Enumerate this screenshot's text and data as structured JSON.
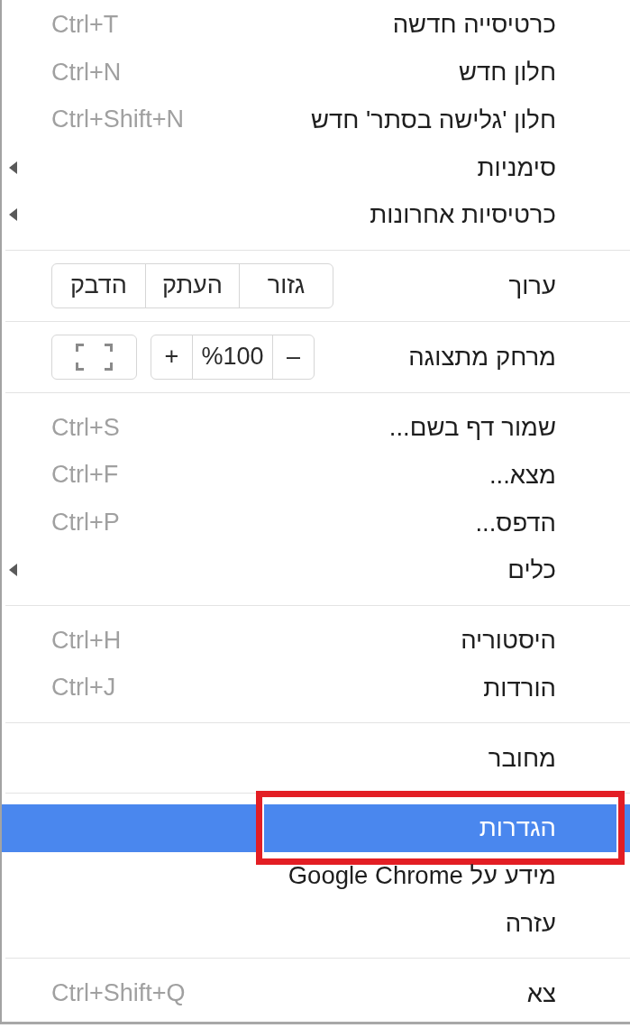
{
  "menu": {
    "sections": [
      {
        "rows": [
          {
            "kind": "item",
            "label": "כרטיסייה חדשה",
            "shortcut": "Ctrl+T",
            "submenu": false,
            "selected": false,
            "framed": false
          },
          {
            "kind": "item",
            "label": "חלון חדש",
            "shortcut": "Ctrl+N",
            "submenu": false,
            "selected": false,
            "framed": false
          },
          {
            "kind": "item",
            "label": "חלון 'גלישה בסתר' חדש",
            "shortcut": "Ctrl+Shift+N",
            "submenu": false,
            "selected": false,
            "framed": false
          },
          {
            "kind": "item",
            "label": "סימניות",
            "submenu": true,
            "selected": false,
            "framed": false
          },
          {
            "kind": "item",
            "label": "כרטיסיות אחרונות",
            "submenu": true,
            "selected": false,
            "framed": false
          }
        ]
      },
      {
        "rows": [
          {
            "kind": "edit",
            "label": "ערוך",
            "buttons": [
              "גזור",
              "העתק",
              "הדבק"
            ]
          }
        ]
      },
      {
        "rows": [
          {
            "kind": "zoom",
            "label": "מרחק מתצוגה",
            "zoom_out": "–",
            "zoom_value": "%100",
            "zoom_in": "+"
          }
        ]
      },
      {
        "rows": [
          {
            "kind": "item",
            "label": "שמור דף בשם...",
            "shortcut": "Ctrl+S",
            "submenu": false,
            "selected": false,
            "framed": false
          },
          {
            "kind": "item",
            "label": "מצא...",
            "shortcut": "Ctrl+F",
            "submenu": false,
            "selected": false,
            "framed": false
          },
          {
            "kind": "item",
            "label": "הדפס...",
            "shortcut": "Ctrl+P",
            "submenu": false,
            "selected": false,
            "framed": false
          },
          {
            "kind": "item",
            "label": "כלים",
            "submenu": true,
            "selected": false,
            "framed": false
          }
        ]
      },
      {
        "rows": [
          {
            "kind": "item",
            "label": "היסטוריה",
            "shortcut": "Ctrl+H",
            "submenu": false,
            "selected": false,
            "framed": false
          },
          {
            "kind": "item",
            "label": "הורדות",
            "shortcut": "Ctrl+J",
            "submenu": false,
            "selected": false,
            "framed": false
          }
        ]
      },
      {
        "rows": [
          {
            "kind": "item",
            "label": "מחובר",
            "submenu": false,
            "selected": false,
            "framed": false
          }
        ]
      },
      {
        "rows": [
          {
            "kind": "item",
            "label": "הגדרות",
            "submenu": false,
            "selected": true,
            "framed": true
          },
          {
            "kind": "item",
            "label": "מידע על Google Chrome",
            "submenu": false,
            "selected": false,
            "framed": false
          },
          {
            "kind": "item",
            "label": "עזרה",
            "submenu": false,
            "selected": false,
            "framed": false
          }
        ]
      },
      {
        "rows": [
          {
            "kind": "item",
            "label": "צא",
            "shortcut": "Ctrl+Shift+Q",
            "submenu": false,
            "selected": false,
            "framed": false
          }
        ]
      }
    ]
  }
}
